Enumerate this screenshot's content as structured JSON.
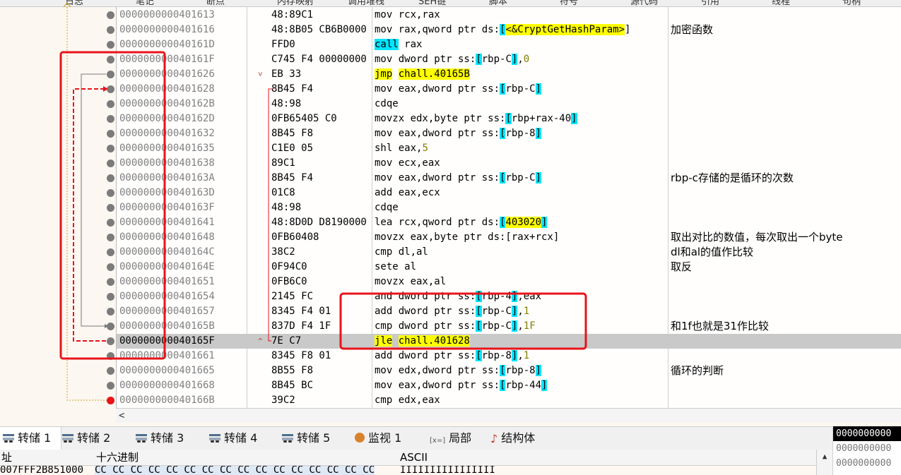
{
  "top_tabs": [
    "日志",
    "笔记",
    "断点",
    "内存映射",
    "调用堆栈",
    "SEH链",
    "脚本",
    "符号",
    "源代码",
    "引用",
    "线程",
    "句柄"
  ],
  "rows": [
    {
      "addr": "0000000000401613",
      "hex": "48:89C1",
      "dis": [
        {
          "t": "mov rcx,rax"
        }
      ],
      "cmt": ""
    },
    {
      "addr": "0000000000401616",
      "hex": "48:8B05 CB6B0000",
      "dis": [
        {
          "t": "mov rax,qword ptr ds:"
        },
        {
          "t": "[",
          "c": "brk"
        },
        {
          "t": "<&CryptGetHashParam>",
          "c": "lbl"
        },
        {
          "t": "]"
        }
      ],
      "cmt": "加密函数"
    },
    {
      "addr": "000000000040161D",
      "hex": "FFD0",
      "dis": [
        {
          "t": "call",
          "c": "kw-call"
        },
        {
          "t": " rax"
        }
      ],
      "cmt": ""
    },
    {
      "addr": "000000000040161F",
      "hex": "C745 F4 00000000",
      "dis": [
        {
          "t": "mov dword ptr ss:"
        },
        {
          "t": "[",
          "c": "brk"
        },
        {
          "t": "rbp-C"
        },
        {
          "t": "]",
          "c": "brk"
        },
        {
          "t": ","
        },
        {
          "t": "0",
          "c": "num"
        }
      ],
      "cmt": ""
    },
    {
      "addr": "0000000000401626",
      "hex": "EB 33",
      "mark": "˅",
      "dis": [
        {
          "t": "jmp",
          "c": "kw-jmp"
        },
        {
          "t": " "
        },
        {
          "t": "chall.40165B",
          "c": "lbl"
        }
      ],
      "cmt": ""
    },
    {
      "addr": "0000000000401628",
      "hex": "8B45 F4",
      "dis": [
        {
          "t": "mov eax,dword ptr ss:"
        },
        {
          "t": "[",
          "c": "brk"
        },
        {
          "t": "rbp-C"
        },
        {
          "t": "]",
          "c": "brk"
        }
      ],
      "cmt": ""
    },
    {
      "addr": "000000000040162B",
      "hex": "48:98",
      "dis": [
        {
          "t": "cdqe"
        }
      ],
      "cmt": ""
    },
    {
      "addr": "000000000040162D",
      "hex": "0FB65405 C0",
      "dis": [
        {
          "t": "movzx edx,byte ptr ss:"
        },
        {
          "t": "[",
          "c": "brk"
        },
        {
          "t": "rbp+rax-40"
        },
        {
          "t": "]",
          "c": "brk"
        }
      ],
      "cmt": ""
    },
    {
      "addr": "0000000000401632",
      "hex": "8B45 F8",
      "dis": [
        {
          "t": "mov eax,dword ptr ss:"
        },
        {
          "t": "[",
          "c": "brk"
        },
        {
          "t": "rbp-8"
        },
        {
          "t": "]",
          "c": "brk"
        }
      ],
      "cmt": ""
    },
    {
      "addr": "0000000000401635",
      "hex": "C1E0 05",
      "dis": [
        {
          "t": "shl eax,"
        },
        {
          "t": "5",
          "c": "num"
        }
      ],
      "cmt": ""
    },
    {
      "addr": "0000000000401638",
      "hex": "89C1",
      "dis": [
        {
          "t": "mov ecx,eax"
        }
      ],
      "cmt": ""
    },
    {
      "addr": "000000000040163A",
      "hex": "8B45 F4",
      "dis": [
        {
          "t": "mov eax,dword ptr ss:"
        },
        {
          "t": "[",
          "c": "brk"
        },
        {
          "t": "rbp-C"
        },
        {
          "t": "]",
          "c": "brk"
        }
      ],
      "cmt": "rbp-c存储的是循环的次数"
    },
    {
      "addr": "000000000040163D",
      "hex": "01C8",
      "dis": [
        {
          "t": "add eax,ecx"
        }
      ],
      "cmt": ""
    },
    {
      "addr": "000000000040163F",
      "hex": "48:98",
      "dis": [
        {
          "t": "cdqe"
        }
      ],
      "cmt": ""
    },
    {
      "addr": "0000000000401641",
      "hex": "48:8D0D D8190000",
      "dis": [
        {
          "t": "lea rcx,qword ptr ds:"
        },
        {
          "t": "[",
          "c": "brk"
        },
        {
          "t": "403020",
          "c": "lbl"
        },
        {
          "t": "]",
          "c": "brk"
        }
      ],
      "cmt": ""
    },
    {
      "addr": "0000000000401648",
      "hex": "0FB60408",
      "dis": [
        {
          "t": "movzx eax,byte ptr ds:[rax+rcx]"
        }
      ],
      "cmt": "取出对比的数值，每次取出一个byte"
    },
    {
      "addr": "000000000040164C",
      "hex": "38C2",
      "dis": [
        {
          "t": "cmp dl,al"
        }
      ],
      "cmt": "dl和al的值作比较"
    },
    {
      "addr": "000000000040164E",
      "hex": "0F94C0",
      "dis": [
        {
          "t": "sete al"
        }
      ],
      "cmt": "取反"
    },
    {
      "addr": "0000000000401651",
      "hex": "0FB6C0",
      "dis": [
        {
          "t": "movzx eax,al"
        }
      ],
      "cmt": ""
    },
    {
      "addr": "0000000000401654",
      "hex": "2145 FC",
      "dis": [
        {
          "t": "and dword ptr ss:"
        },
        {
          "t": "[",
          "c": "brk"
        },
        {
          "t": "rbp-4"
        },
        {
          "t": "]",
          "c": "brk"
        },
        {
          "t": ",eax"
        }
      ],
      "cmt": ""
    },
    {
      "addr": "0000000000401657",
      "hex": "8345 F4 01",
      "dis": [
        {
          "t": "add dword ptr ss:"
        },
        {
          "t": "[",
          "c": "brk"
        },
        {
          "t": "rbp-C"
        },
        {
          "t": "]",
          "c": "brk"
        },
        {
          "t": ","
        },
        {
          "t": "1",
          "c": "num"
        }
      ],
      "cmt": ""
    },
    {
      "addr": "000000000040165B",
      "hex": "837D F4 1F",
      "dis": [
        {
          "t": "cmp dword ptr ss:"
        },
        {
          "t": "[",
          "c": "brk"
        },
        {
          "t": "rbp-C"
        },
        {
          "t": "]",
          "c": "brk"
        },
        {
          "t": ","
        },
        {
          "t": "1F",
          "c": "num"
        }
      ],
      "cmt": "和1f也就是31作比较"
    },
    {
      "addr": "000000000040165F",
      "hex": "7E C7",
      "mark": "^",
      "sel": true,
      "dis": [
        {
          "t": "jle",
          "c": "kw-jmp"
        },
        {
          "t": " "
        },
        {
          "t": "chall.401628",
          "c": "lbl"
        }
      ],
      "cmt": ""
    },
    {
      "addr": "0000000000401661",
      "hex": "8345 F8 01",
      "dis": [
        {
          "t": "add dword ptr ss:"
        },
        {
          "t": "[",
          "c": "brk"
        },
        {
          "t": "rbp-8"
        },
        {
          "t": "]",
          "c": "brk"
        },
        {
          "t": ","
        },
        {
          "t": "1",
          "c": "num"
        }
      ],
      "cmt": ""
    },
    {
      "addr": "0000000000401665",
      "hex": "8B55 F8",
      "dis": [
        {
          "t": "mov edx,dword ptr ss:"
        },
        {
          "t": "[",
          "c": "brk"
        },
        {
          "t": "rbp-8"
        },
        {
          "t": "]",
          "c": "brk"
        }
      ],
      "cmt": "循环的判断"
    },
    {
      "addr": "0000000000401668",
      "hex": "8B45 BC",
      "dis": [
        {
          "t": "mov eax,dword ptr ss:"
        },
        {
          "t": "[",
          "c": "brk"
        },
        {
          "t": "rbp-44"
        },
        {
          "t": "]",
          "c": "brk"
        }
      ],
      "cmt": ""
    },
    {
      "addr": "000000000040166B",
      "hex": "39C2",
      "dis": [
        {
          "t": "cmp edx,eax"
        }
      ],
      "cmt": ""
    }
  ],
  "bottom_tabs": [
    {
      "label": "转储 1",
      "icon": "dump-icon"
    },
    {
      "label": "转储 2",
      "icon": "dump-icon"
    },
    {
      "label": "转储 3",
      "icon": "dump-icon"
    },
    {
      "label": "转储 4",
      "icon": "dump-icon"
    },
    {
      "label": "转储 5",
      "icon": "dump-icon"
    },
    {
      "label": "监视 1",
      "icon": "watch-icon"
    },
    {
      "label": "局部",
      "icon": "locals-icon",
      "icon_text": "[x=]"
    },
    {
      "label": "结构体",
      "icon": "struct-icon"
    }
  ],
  "dump_header": {
    "addr": "址",
    "hex": "十六进制",
    "ascii": "ASCII"
  },
  "dump_row": {
    "addr": "007FFF2B851000",
    "hex": "CC CC CC CC  CC CC CC CC  CC CC CC CC  CC CC CC CC",
    "ascii": "ÌÌÌÌÌÌÌÌÌÌÌÌÌÌÌÌ"
  },
  "right_panel": [
    "0000000000",
    "0000000000",
    "0000000000"
  ],
  "colors": {
    "accent_red": "#e8141a",
    "cyan": "#00e5ff",
    "yellow": "#ffff00",
    "selected_row": "#c9c9c9"
  }
}
